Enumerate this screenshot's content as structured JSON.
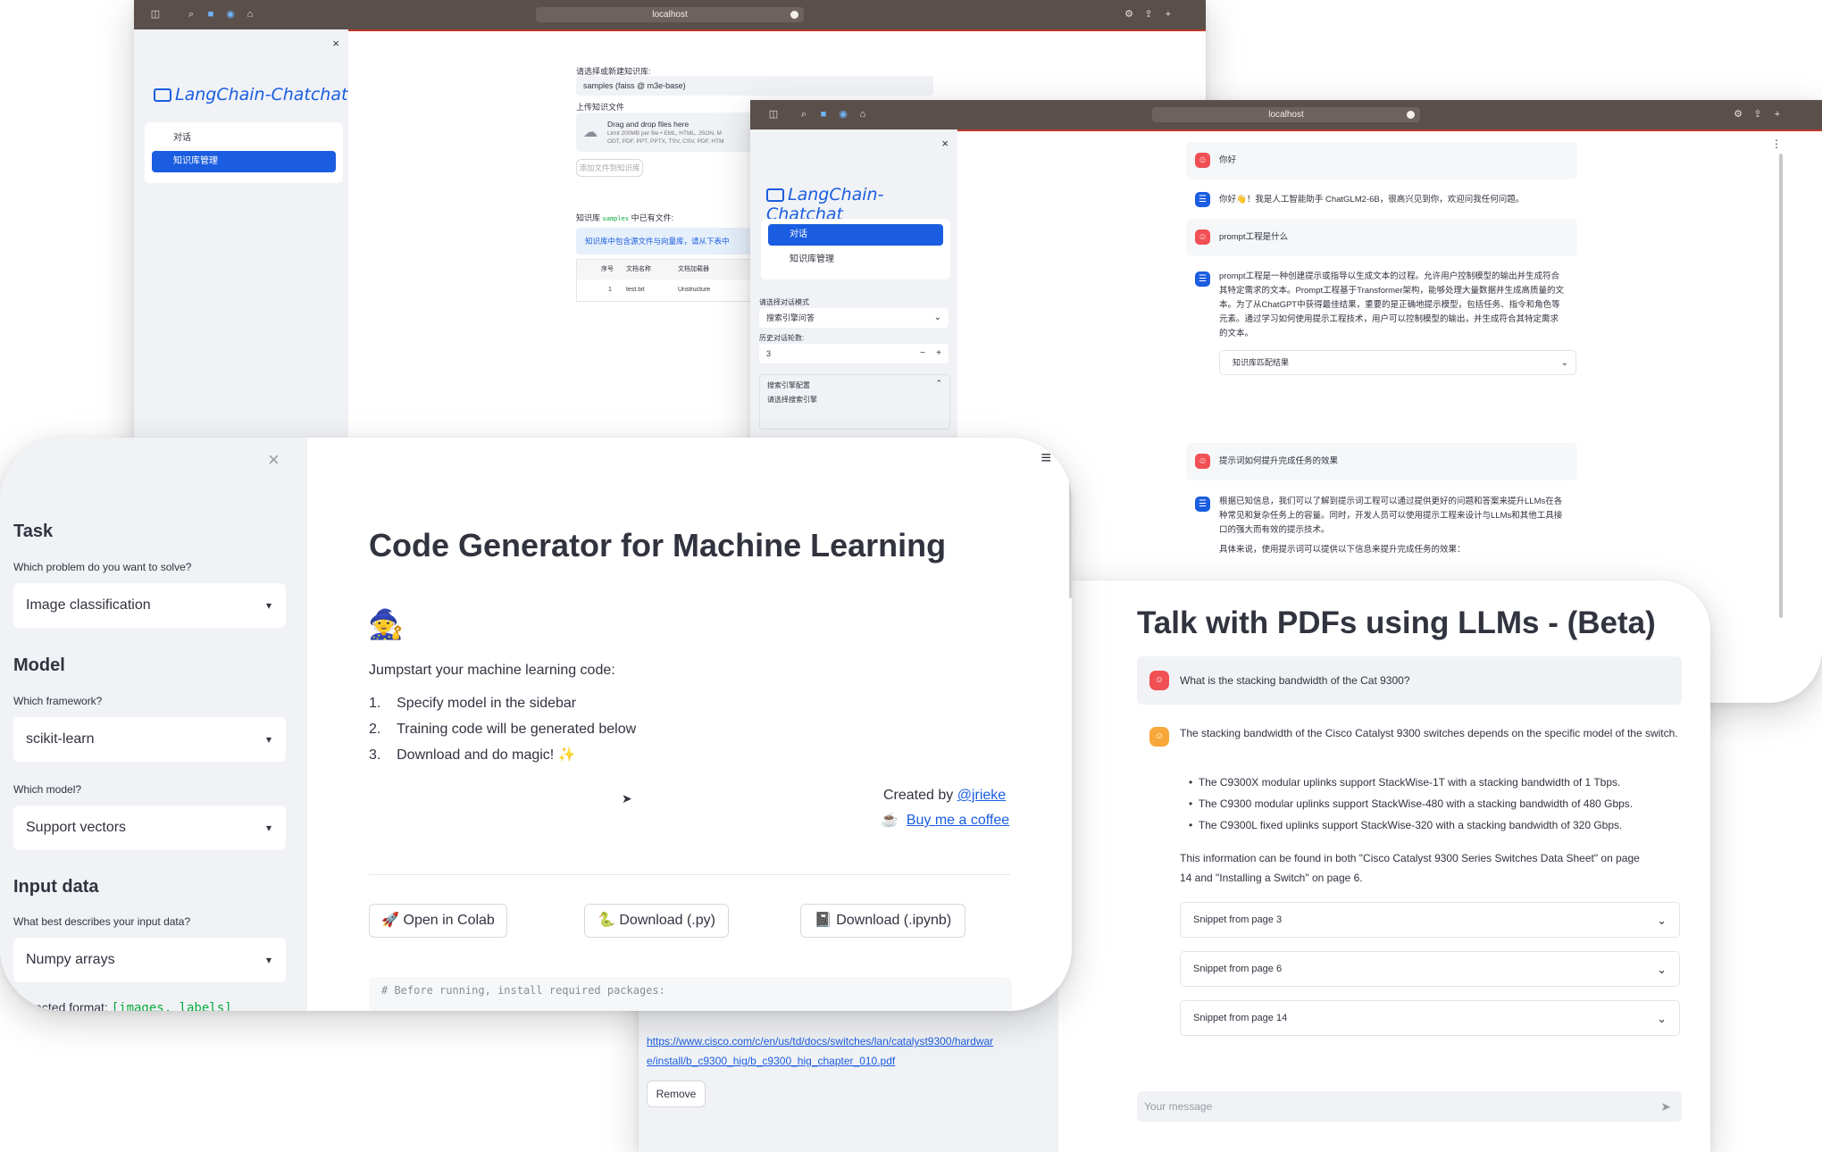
{
  "knowledge_window": {
    "url": "localhost",
    "logo": "LangChain-Chatchat",
    "menu": [
      "对话",
      "知识库管理"
    ],
    "select_kb_label": "请选择或新建知识库:",
    "select_kb_value": "samples (faiss @ m3e-base)",
    "upload_label": "上传知识文件",
    "drop_title": "Drag and drop files here",
    "drop_sub1": "Limit 200MB per file • EML, HTML, JSON, M",
    "drop_sub2": "ODT, PDF, PPT, PPTX, TSV, CSV, PDF, HTM",
    "add_button": "添加文件到知识库",
    "kb_files_prefix": "知识库",
    "kb_files_code": "samples",
    "kb_files_suffix": "中已有文件:",
    "info_text": "知识库中包含源文件与向量库，请从下表中",
    "table_headers": [
      "序号",
      "文档名称",
      "文档加载器"
    ],
    "table_row": [
      "1",
      "test.txt",
      "Unstructure"
    ]
  },
  "chat_window": {
    "url": "localhost",
    "logo": "LangChain-Chatchat",
    "menu": [
      "对话",
      "知识库管理"
    ],
    "mode_label": "请选择对话模式",
    "mode_value": "搜索引擎问答",
    "history_label": "历史对话轮数:",
    "history_value": "3",
    "search_config": "搜索引擎配置",
    "search_select": "请选择搜索引擎",
    "messages": [
      {
        "role": "user",
        "text": "你好"
      },
      {
        "role": "bot",
        "text": "你好👋！我是人工智能助手 ChatGLM2-6B，很高兴见到你，欢迎问我任何问题。"
      },
      {
        "role": "user",
        "text": "prompt工程是什么"
      },
      {
        "role": "bot",
        "lines": [
          "prompt工程是一种创建提示或指导以生成文本的过程。允许用户控制模型的输出并生成符合",
          "其特定需求的文本。Prompt工程基于Transformer架构，能够处理大量数据并生成高质量的文",
          "本。为了从ChatGPT中获得最佳结果，重要的是正确地提示模型，包括任务、指令和角色等",
          "元素。通过学习如何使用提示工程技术，用户可以控制模型的输出，并生成符合其特定需求",
          "的文本。"
        ]
      },
      {
        "role": "user",
        "text": "提示词如何提升完成任务的效果"
      },
      {
        "role": "bot",
        "lines": [
          "根据已知信息，我们可以了解到提示词工程可以通过提供更好的问题和答案来提升LLMs在各",
          "种常见和复杂任务上的容量。同时，开发人员可以使用提示工程来设计与LLMs和其他工具接",
          "口的强大而有效的提示技术。",
          "具体来说，使用提示词可以提供以下信息来提升完成任务的效果："
        ]
      }
    ],
    "expander": "知识库匹配结果"
  },
  "pdf_window": {
    "title": "Talk with PDFs using LLMs - (Beta)",
    "question": "What is the stacking bandwidth of the Cat 9300?",
    "answer_intro": "The stacking bandwidth of the Cisco Catalyst 9300 switches depends on the specific model of the switch.",
    "bullets": [
      "The C9300X modular uplinks support StackWise-1T with a stacking bandwidth of 1 Tbps.",
      "The C9300 modular uplinks support StackWise-480 with a stacking bandwidth of 480 Gbps.",
      "The C9300L fixed uplinks support StackWise-320 with a stacking bandwidth of 320 Gbps."
    ],
    "answer_outro_1": "This information can be found in both \"Cisco Catalyst 9300 Series Switches Data Sheet\" on page",
    "answer_outro_2": "14 and \"Installing a Switch\" on page 6.",
    "snippets": [
      "Snippet from page 3",
      "Snippet from page 6",
      "Snippet from page 14"
    ],
    "input_placeholder": "Your message",
    "side_link_1": "https://www.cisco.com/c/en/us/td/docs/switches/lan/catalyst9300/hardwar",
    "side_link_2": "e/install/b_c9300_hig/b_c9300_hig_chapter_010.pdf",
    "remove_button": "Remove"
  },
  "codegen_window": {
    "sidebar": {
      "task_heading": "Task",
      "task_help": "Which problem do you want to solve?",
      "task_value": "Image classification",
      "model_heading": "Model",
      "framework_help": "Which framework?",
      "framework_value": "scikit-learn",
      "model_help": "Which model?",
      "model_value": "Support vectors",
      "input_heading": "Input data",
      "input_help": "What best describes your input data?",
      "input_value": "Numpy arrays",
      "expected_label": "Expected format:",
      "expected_code": "[images, labels]"
    },
    "title": "Code Generator for Machine Learning",
    "emoji": "🧙",
    "intro": "Jumpstart your machine learning code:",
    "steps": [
      "Specify model in the sidebar",
      "Training code will be generated below",
      "Download and do magic! ✨"
    ],
    "created_by": "Created by",
    "author": "@jrieke",
    "coffee_icon": "☕",
    "coffee": "Buy me a coffee",
    "buttons": {
      "colab": "Open in Colab",
      "py": "Download (.py)",
      "ipynb": "Download (.ipynb)"
    },
    "button_icons": {
      "colab": "🚀",
      "py": "🐍",
      "ipynb": "📓"
    },
    "code_line": "# Before running, install required packages:"
  }
}
